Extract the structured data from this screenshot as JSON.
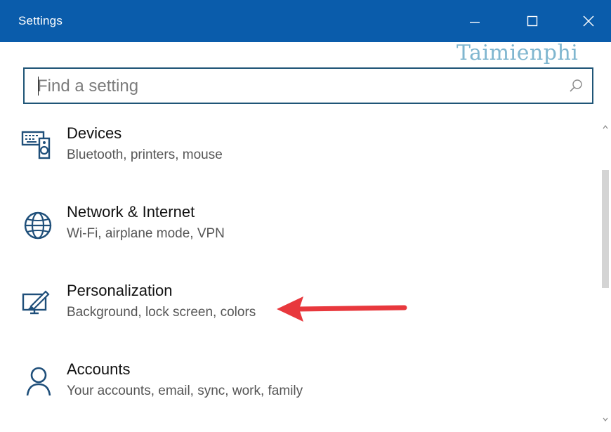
{
  "window": {
    "title": "Settings",
    "minimize_icon": "minimize-icon",
    "maximize_icon": "maximize-icon",
    "close_icon": "close-icon",
    "accent": "#0a5cab"
  },
  "watermark": {
    "text": "Taimienphi"
  },
  "search": {
    "placeholder": "Find a setting",
    "value": "",
    "icon": "search-icon"
  },
  "categories": [
    {
      "label": "Devices",
      "description": "Bluetooth, printers, mouse",
      "icon": "devices-icon"
    },
    {
      "label": "Network & Internet",
      "description": "Wi-Fi, airplane mode, VPN",
      "icon": "globe-icon"
    },
    {
      "label": "Personalization",
      "description": "Background, lock screen, colors",
      "icon": "personalization-icon"
    },
    {
      "label": "Accounts",
      "description": "Your accounts, email, sync, work, family",
      "icon": "person-icon"
    }
  ],
  "annotation": {
    "icon": "red-arrow-pointer",
    "color": "#e8383d",
    "points_to": "Personalization"
  },
  "scrollbar": {
    "position_fraction": 0.3
  }
}
